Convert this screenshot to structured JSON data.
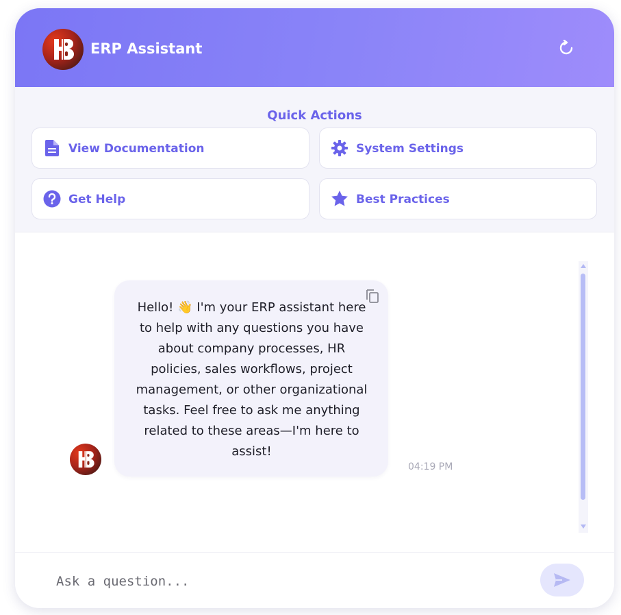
{
  "header": {
    "title": "ERP Assistant",
    "logo_text": "HB",
    "refresh_icon": "refresh-icon"
  },
  "quick_actions": {
    "title": "Quick Actions",
    "items": [
      {
        "label": "View Documentation",
        "icon": "document-icon"
      },
      {
        "label": "System Settings",
        "icon": "gear-icon"
      },
      {
        "label": "Get Help",
        "icon": "question-icon"
      },
      {
        "label": "Best Practices",
        "icon": "star-icon"
      }
    ]
  },
  "messages": [
    {
      "sender": "assistant",
      "text": "Hello! 👋 I'm your ERP assistant here to help with any questions you have about company processes, HR policies, sales workflows, project management, or other organizational tasks. Feel free to ask me anything related to these areas—I'm here to assist!",
      "time": "04:19 PM"
    }
  ],
  "input": {
    "placeholder": "Ask a question..."
  },
  "colors": {
    "accent": "#6a63ea",
    "header_start": "#7b76f5",
    "header_end": "#9e8cfb"
  }
}
